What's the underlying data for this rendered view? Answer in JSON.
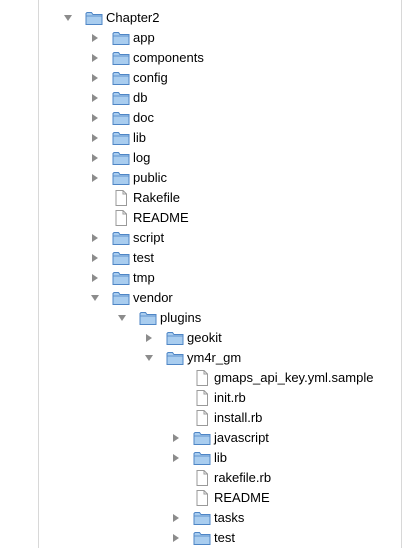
{
  "tree": {
    "rows": [
      {
        "label": "Chapter2",
        "type": "folder",
        "depth": 0,
        "expanded": true
      },
      {
        "label": "app",
        "type": "folder",
        "depth": 1,
        "expanded": false
      },
      {
        "label": "components",
        "type": "folder",
        "depth": 1,
        "expanded": false
      },
      {
        "label": "config",
        "type": "folder",
        "depth": 1,
        "expanded": false
      },
      {
        "label": "db",
        "type": "folder",
        "depth": 1,
        "expanded": false
      },
      {
        "label": "doc",
        "type": "folder",
        "depth": 1,
        "expanded": false
      },
      {
        "label": "lib",
        "type": "folder",
        "depth": 1,
        "expanded": false
      },
      {
        "label": "log",
        "type": "folder",
        "depth": 1,
        "expanded": false
      },
      {
        "label": "public",
        "type": "folder",
        "depth": 1,
        "expanded": false
      },
      {
        "label": "Rakefile",
        "type": "file",
        "depth": 1
      },
      {
        "label": "README",
        "type": "file",
        "depth": 1
      },
      {
        "label": "script",
        "type": "folder",
        "depth": 1,
        "expanded": false
      },
      {
        "label": "test",
        "type": "folder",
        "depth": 1,
        "expanded": false
      },
      {
        "label": "tmp",
        "type": "folder",
        "depth": 1,
        "expanded": false
      },
      {
        "label": "vendor",
        "type": "folder",
        "depth": 1,
        "expanded": true
      },
      {
        "label": "plugins",
        "type": "folder",
        "depth": 2,
        "expanded": true
      },
      {
        "label": "geokit",
        "type": "folder",
        "depth": 3,
        "expanded": false
      },
      {
        "label": "ym4r_gm",
        "type": "folder",
        "depth": 3,
        "expanded": true
      },
      {
        "label": "gmaps_api_key.yml.sample",
        "type": "file",
        "depth": 4
      },
      {
        "label": "init.rb",
        "type": "file",
        "depth": 4
      },
      {
        "label": "install.rb",
        "type": "file",
        "depth": 4
      },
      {
        "label": "javascript",
        "type": "folder",
        "depth": 4,
        "expanded": false
      },
      {
        "label": "lib",
        "type": "folder",
        "depth": 4,
        "expanded": false
      },
      {
        "label": "rakefile.rb",
        "type": "file",
        "depth": 4
      },
      {
        "label": "README",
        "type": "file",
        "depth": 4
      },
      {
        "label": "tasks",
        "type": "folder",
        "depth": 4,
        "expanded": false
      },
      {
        "label": "test",
        "type": "folder",
        "depth": 4,
        "expanded": false
      }
    ]
  },
  "colors": {
    "disclosure_triangle": "#8c8c8c",
    "folder_fill": "#a9cdef",
    "folder_stroke": "#4f86c6",
    "file_fill": "#ffffff",
    "file_stroke": "#9a9a9a"
  }
}
